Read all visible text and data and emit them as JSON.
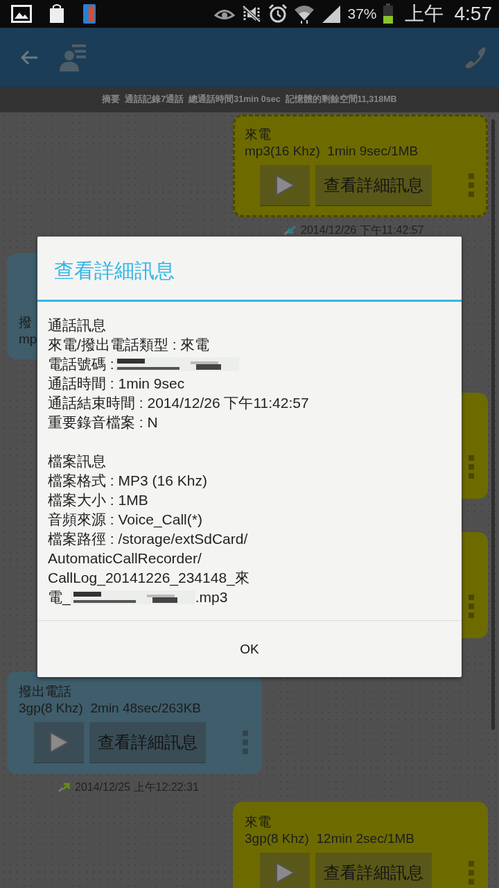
{
  "status_bar": {
    "battery_text": "37%",
    "ampm": "上午",
    "time": "4:57"
  },
  "summary": "摘要  通話記錄7通話  總通話時間31min 0sec  記憶體的剩餘空間11,318MB",
  "cards": [
    {
      "kind": "incoming",
      "selected": true,
      "label": "來電",
      "detail": "mp3(16 Khz)  1min 9sec/1MB",
      "details_button": "查看詳細訊息",
      "timestamp": "2014/12/26 下午11:42:57"
    },
    {
      "kind": "outgoing",
      "selected": false,
      "label": "撥",
      "detail": "mp"
    },
    {
      "kind": "incoming",
      "selected": false
    },
    {
      "kind": "incoming",
      "selected": false
    },
    {
      "kind": "outgoing",
      "selected": false,
      "label": "撥出電話",
      "detail": "3gp(8 Khz)  2min 48sec/263KB",
      "details_button": "查看詳細訊息",
      "timestamp": "2014/12/25 上午12:22:31"
    },
    {
      "kind": "incoming",
      "selected": false,
      "label": "來電",
      "detail": "3gp(8 Khz)  12min 2sec/1MB",
      "details_button": "查看詳細訊息"
    }
  ],
  "dialog": {
    "title": "查看詳細訊息",
    "lines": [
      {
        "kind": "text",
        "text": "通話訊息"
      },
      {
        "kind": "text",
        "text": "來電/撥出電話類型 : 來電"
      },
      {
        "kind": "redacted",
        "before": "電話號碼 :"
      },
      {
        "kind": "text",
        "text": "通話時間 : 1min 9sec"
      },
      {
        "kind": "text",
        "text": "通話結束時間 : 2014/12/26 下午11:42:57"
      },
      {
        "kind": "text",
        "text": "重要錄音檔案 : N"
      },
      {
        "kind": "blank"
      },
      {
        "kind": "text",
        "text": "檔案訊息"
      },
      {
        "kind": "text",
        "text": "檔案格式 : MP3 (16 Khz)"
      },
      {
        "kind": "text",
        "text": "檔案大小 : 1MB"
      },
      {
        "kind": "text",
        "text": "音頻來源 : Voice_Call(*)"
      },
      {
        "kind": "text",
        "text": "檔案路徑 : /storage/extSdCard/"
      },
      {
        "kind": "text",
        "text": "AutomaticCallRecorder/"
      },
      {
        "kind": "text",
        "text": "CallLog_20141226_234148_來"
      },
      {
        "kind": "redacted",
        "before": "電_",
        "after": ".mp3"
      }
    ],
    "ok_button": "OK"
  }
}
